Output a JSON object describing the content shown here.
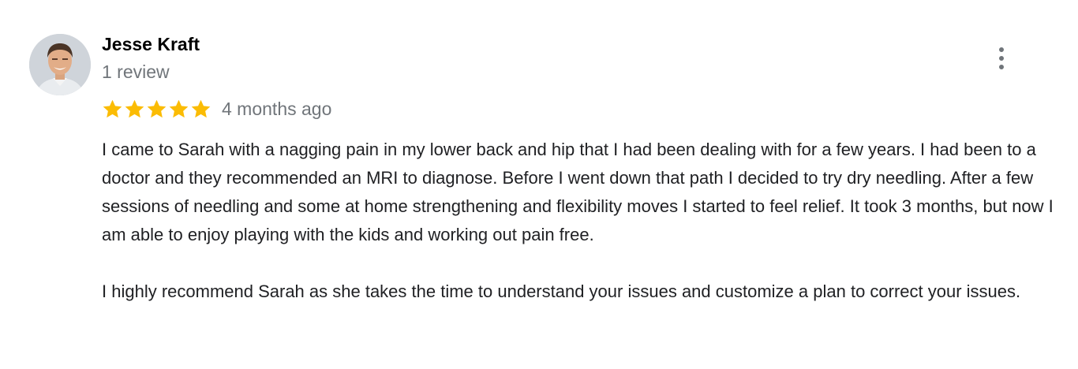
{
  "review": {
    "author": "Jesse Kraft",
    "review_count": "1 review",
    "rating": 5,
    "max_rating": 5,
    "date": "4 months ago",
    "star_color": "#fbbc04",
    "more_icon": "more-vert-icon",
    "paragraphs": [
      "I came to Sarah with a nagging pain in my lower back and hip that I had been dealing with for a few years. I had been to a doctor and they recommended an MRI to diagnose. Before I went down that path I decided to try dry needling. After a few sessions of needling and some at home strengthening and flexibility moves I started to feel relief. It took 3 months, but now I am able to enjoy playing with the kids and working out pain free.",
      "I highly recommend Sarah as she takes the time to understand your issues and customize a plan to correct your issues."
    ]
  }
}
